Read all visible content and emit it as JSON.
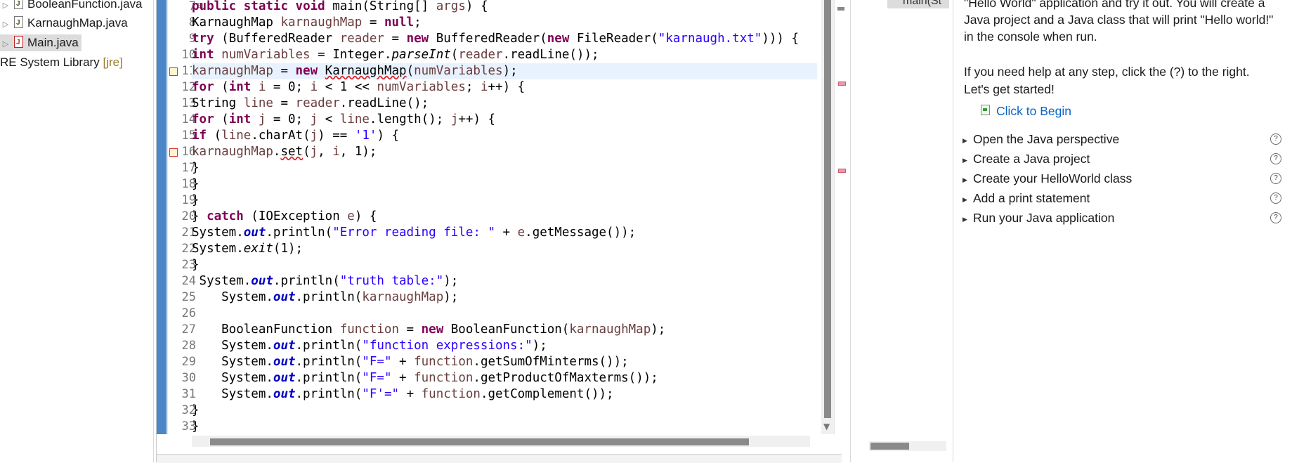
{
  "explorer": {
    "items": [
      {
        "label": "BooleanFunction.java",
        "selected": false,
        "icon": "java-file-icon"
      },
      {
        "label": "KarnaughMap.java",
        "selected": false,
        "icon": "java-file-icon"
      },
      {
        "label": "Main.java",
        "selected": true,
        "icon": "java-file-error-icon"
      }
    ],
    "library": {
      "label": "RE System Library",
      "suffix": "[jre]"
    }
  },
  "editor": {
    "lines": [
      {
        "n": "7",
        "html": "<span class=\"kw\">public</span> <span class=\"kw\">static</span> <span class=\"kw\">void</span> main(String[] <span class=\"var\">args</span>) {",
        "fold": true
      },
      {
        "n": "8",
        "html": "KarnaughMap <span class=\"var\">karnaughMap</span> = <span class=\"kw\">null</span>;"
      },
      {
        "n": "9",
        "html": "<span class=\"kw\">try</span> (BufferedReader <span class=\"var\">reader</span> = <span class=\"kw\">new</span> BufferedReader(<span class=\"kw\">new</span> FileReader(<span class=\"str\">\"karnaugh.txt\"</span>))) {"
      },
      {
        "n": "10",
        "html": "<span class=\"kw\">int</span> <span class=\"var\">numVariables</span> = Integer.<span class=\"ital\">parseInt</span>(<span class=\"var\">reader</span>.readLine());"
      },
      {
        "n": "11",
        "html": "<span class=\"var\">karnaughMap</span> = <span class=\"kw\">new</span> <span class=\"squig\">KarnaughMap</span>(<span class=\"var\">numVariables</span>);",
        "current": true,
        "error": true
      },
      {
        "n": "12",
        "html": "<span class=\"kw\">for</span> (<span class=\"kw\">int</span> <span class=\"var\">i</span> = 0; <span class=\"var\">i</span> &lt; 1 &lt;&lt; <span class=\"var\">numVariables</span>; <span class=\"var\">i</span>++) {"
      },
      {
        "n": "13",
        "html": "String <span class=\"var\">line</span> = <span class=\"var\">reader</span>.readLine();"
      },
      {
        "n": "14",
        "html": "<span class=\"kw\">for</span> (<span class=\"kw\">int</span> <span class=\"var\">j</span> = 0; <span class=\"var\">j</span> &lt; <span class=\"var\">line</span>.length(); <span class=\"var\">j</span>++) {"
      },
      {
        "n": "15",
        "html": "<span class=\"kw\">if</span> (<span class=\"var\">line</span>.charAt(<span class=\"var\">j</span>) == <span class=\"str\">'1'</span>) {"
      },
      {
        "n": "16",
        "html": "<span class=\"var\">karnaughMap</span>.<span class=\"squig\">set</span>(<span class=\"var\">j</span>, <span class=\"var\">i</span>, 1);",
        "error": true
      },
      {
        "n": "17",
        "html": "}"
      },
      {
        "n": "18",
        "html": "}"
      },
      {
        "n": "19",
        "html": "}"
      },
      {
        "n": "20",
        "html": "} <span class=\"kw\">catch</span> (IOException <span class=\"var\">e</span>) {"
      },
      {
        "n": "21",
        "html": "System.<span class=\"fld\">out</span>.println(<span class=\"str\">\"Error reading file: \"</span> + <span class=\"var\">e</span>.getMessage());"
      },
      {
        "n": "22",
        "html": "System.<span class=\"ital\">exit</span>(1);"
      },
      {
        "n": "23",
        "html": "}"
      },
      {
        "n": "24",
        "html": " System.<span class=\"fld\">out</span>.println(<span class=\"str\">\"truth table:\"</span>);"
      },
      {
        "n": "25",
        "html": "    System.<span class=\"fld\">out</span>.println(<span class=\"var\">karnaughMap</span>);"
      },
      {
        "n": "26",
        "html": ""
      },
      {
        "n": "27",
        "html": "    BooleanFunction <span class=\"var\">function</span> = <span class=\"kw\">new</span> BooleanFunction(<span class=\"var\">karnaughMap</span>);"
      },
      {
        "n": "28",
        "html": "    System.<span class=\"fld\">out</span>.println(<span class=\"str\">\"function expressions:\"</span>);"
      },
      {
        "n": "29",
        "html": "    System.<span class=\"fld\">out</span>.println(<span class=\"str\">\"F=\"</span> + <span class=\"var\">function</span>.getSumOfMinterms());"
      },
      {
        "n": "30",
        "html": "    System.<span class=\"fld\">out</span>.println(<span class=\"str\">\"F=\"</span> + <span class=\"var\">function</span>.getProductOfMaxterms());"
      },
      {
        "n": "31",
        "html": "    System.<span class=\"fld\">out</span>.println(<span class=\"str\">\"F'=\"</span> + <span class=\"var\">function</span>.getComplement());"
      },
      {
        "n": "32",
        "html": "}"
      },
      {
        "n": "33",
        "html": "}"
      }
    ]
  },
  "outline": {
    "item": "main(St"
  },
  "cheatsheet": {
    "intro_lines": [
      "\"Hello World\" application and try it out. You will create a",
      "Java project and a Java class that will print \"Hello world!\"",
      "in the console when run.",
      "",
      "If you need help at any step, click the (?) to the right.",
      "Let's get started!"
    ],
    "begin_label": "Click to Begin",
    "steps": [
      "Open the Java perspective",
      "Create a Java project",
      "Create your HelloWorld class",
      "Add a print statement",
      "Run your Java application"
    ],
    "help_glyph": "?"
  },
  "colors": {
    "keyword": "#7f0055",
    "string": "#2a00ff",
    "field": "#0000c0",
    "variable": "#6a3e3e",
    "link": "#0a64c8",
    "ruler": "#4a86c8"
  }
}
